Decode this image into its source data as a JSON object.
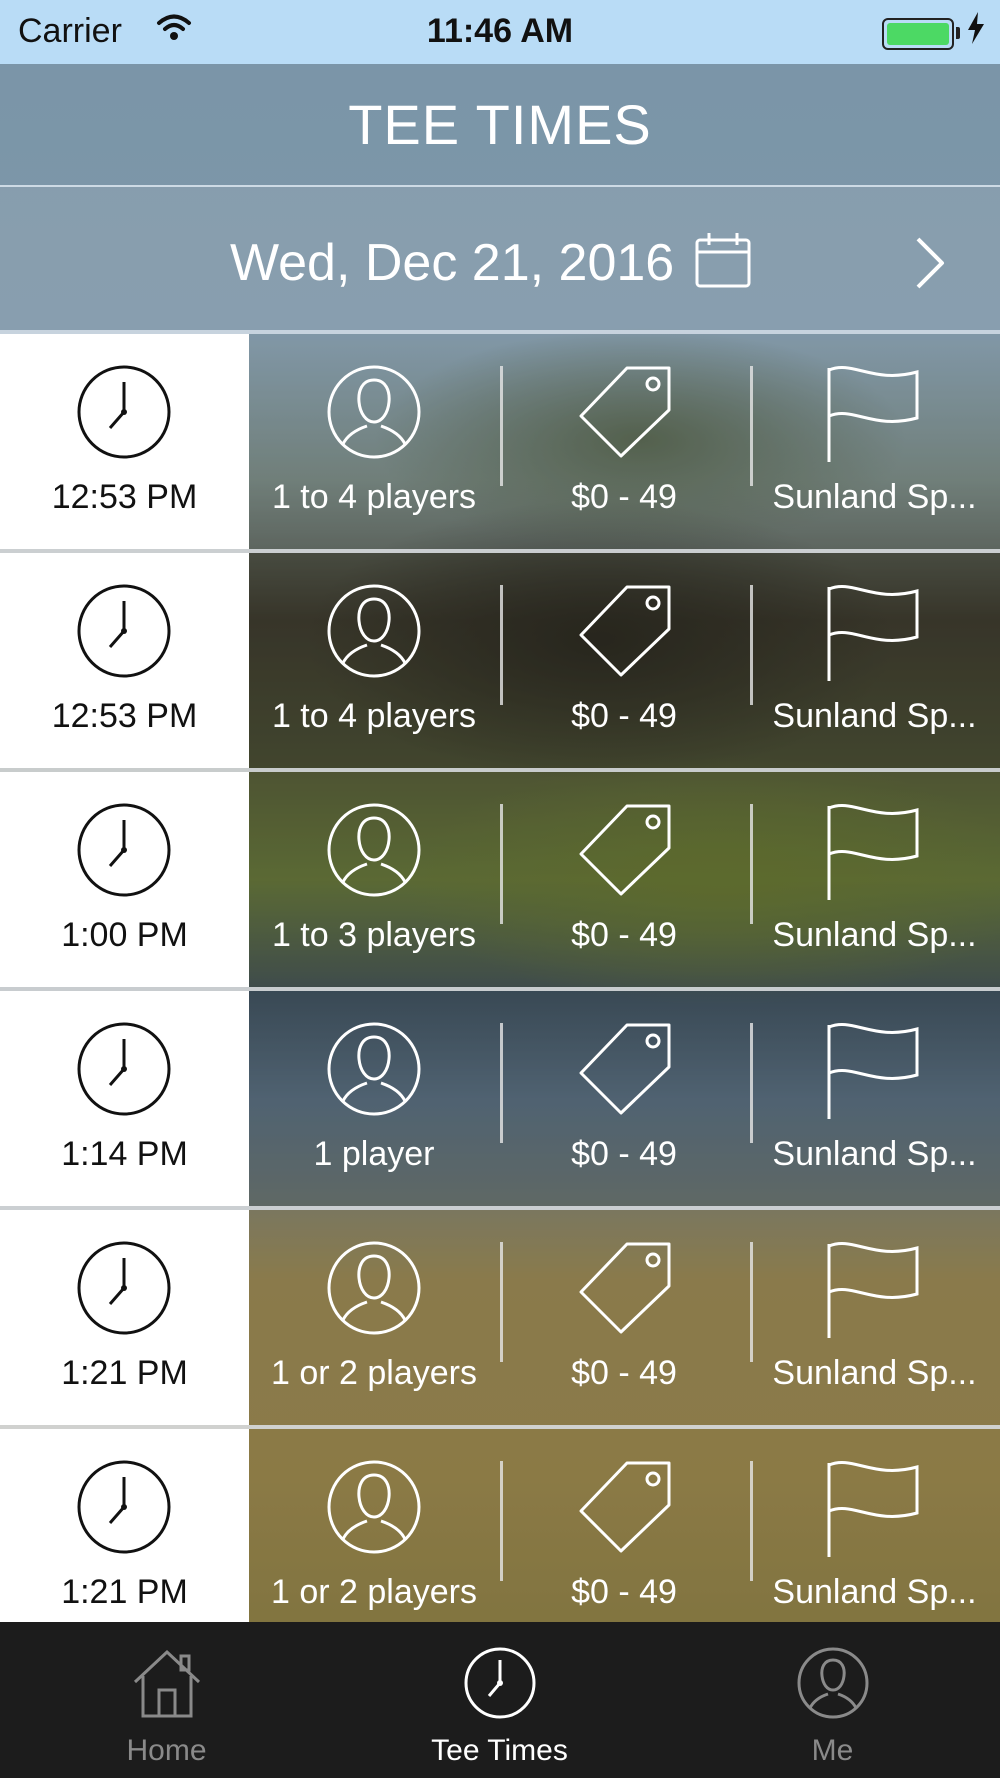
{
  "status_bar": {
    "carrier": "Carrier",
    "time": "11:46 AM",
    "battery_color": "#4cd964"
  },
  "header": {
    "title": "TEE TIMES"
  },
  "date_bar": {
    "date": "Wed, Dec 21, 2016",
    "calendar_icon": "calendar-icon",
    "next_icon": "chevron-right-icon"
  },
  "tee_times": [
    {
      "time": "12:53 PM",
      "players": "1 to 4 players",
      "price": "$0 - 49",
      "course": "Sunland Sp..."
    },
    {
      "time": "12:53 PM",
      "players": "1 to 4 players",
      "price": "$0 - 49",
      "course": "Sunland Sp..."
    },
    {
      "time": "1:00 PM",
      "players": "1 to 3 players",
      "price": "$0 - 49",
      "course": "Sunland Sp..."
    },
    {
      "time": "1:14 PM",
      "players": "1 player",
      "price": "$0 - 49",
      "course": "Sunland Sp..."
    },
    {
      "time": "1:21 PM",
      "players": "1 or 2 players",
      "price": "$0 - 49",
      "course": "Sunland Sp..."
    },
    {
      "time": "1:21 PM",
      "players": "1 or 2 players",
      "price": "$0 - 49",
      "course": "Sunland Sp..."
    }
  ],
  "tab_bar": {
    "items": [
      {
        "label": "Home",
        "icon": "home-icon",
        "active": false
      },
      {
        "label": "Tee Times",
        "icon": "clock-icon",
        "active": true
      },
      {
        "label": "Me",
        "icon": "person-icon",
        "active": false
      }
    ]
  }
}
